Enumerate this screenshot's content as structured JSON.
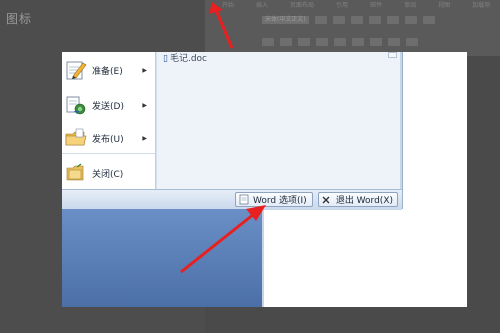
{
  "background": {
    "corner_label": "图标"
  },
  "ribbon": {
    "tabs": [
      "开始",
      "插入",
      "页面布局",
      "引用",
      "邮件",
      "审阅",
      "视图",
      "加载项"
    ],
    "font_name": "宋体(中文正文)"
  },
  "office_menu": {
    "recent_document": "毛记.doc",
    "items": [
      {
        "label": "准备(E)",
        "icon": "prepare-pencil-icon",
        "has_submenu": true
      },
      {
        "label": "发送(D)",
        "icon": "send-icon",
        "has_submenu": true
      },
      {
        "label": "发布(U)",
        "icon": "publish-folder-icon",
        "has_submenu": true
      },
      {
        "label": "关闭(C)",
        "icon": "close-folder-icon",
        "has_submenu": false
      }
    ]
  },
  "bottom_bar": {
    "word_options_label": "Word 选项(I)",
    "exit_word_label": "退出 Word(X)"
  },
  "colors": {
    "annotation_arrow": "#e8201f",
    "menu_background": "#dfe9f5",
    "lower_panel": "#5b7fb6"
  }
}
